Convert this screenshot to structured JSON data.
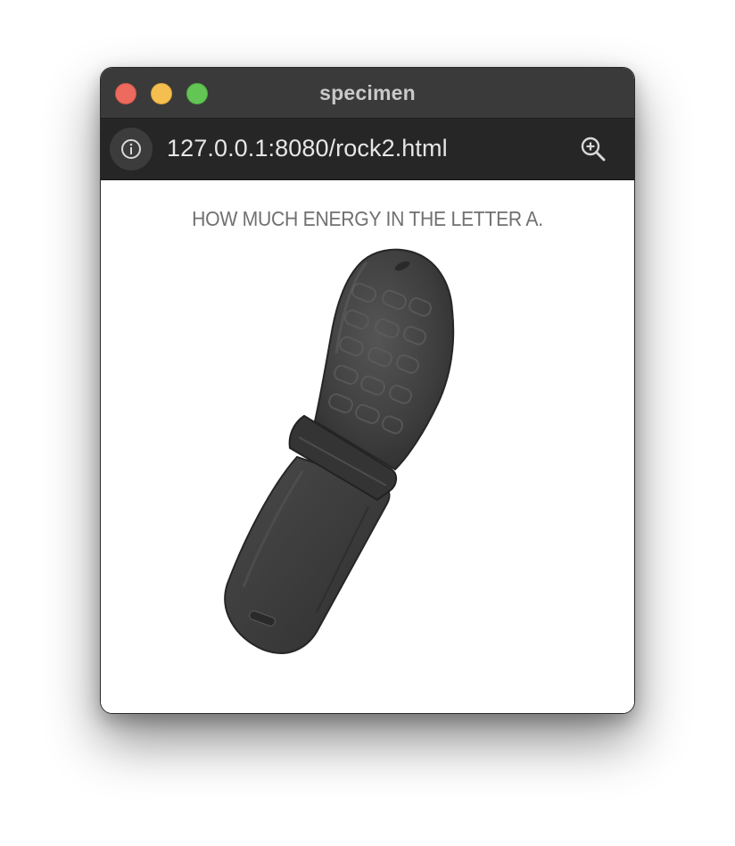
{
  "window": {
    "title": "specimen"
  },
  "urlbar": {
    "url": "127.0.0.1:8080/rock2.html",
    "info_icon": "info-icon",
    "zoom_icon": "zoom-in-icon"
  },
  "page": {
    "caption": "HOW MUCH ENERGY IN THE LETTER A.",
    "image_subject": "flip-phone-shaped rock specimen"
  },
  "colors": {
    "close": "#ed6a5e",
    "minimize": "#f5bf4f",
    "zoom": "#62c554",
    "titlebar": "#3a3a3a",
    "urlbar": "#262626",
    "caption_text": "#707070"
  }
}
